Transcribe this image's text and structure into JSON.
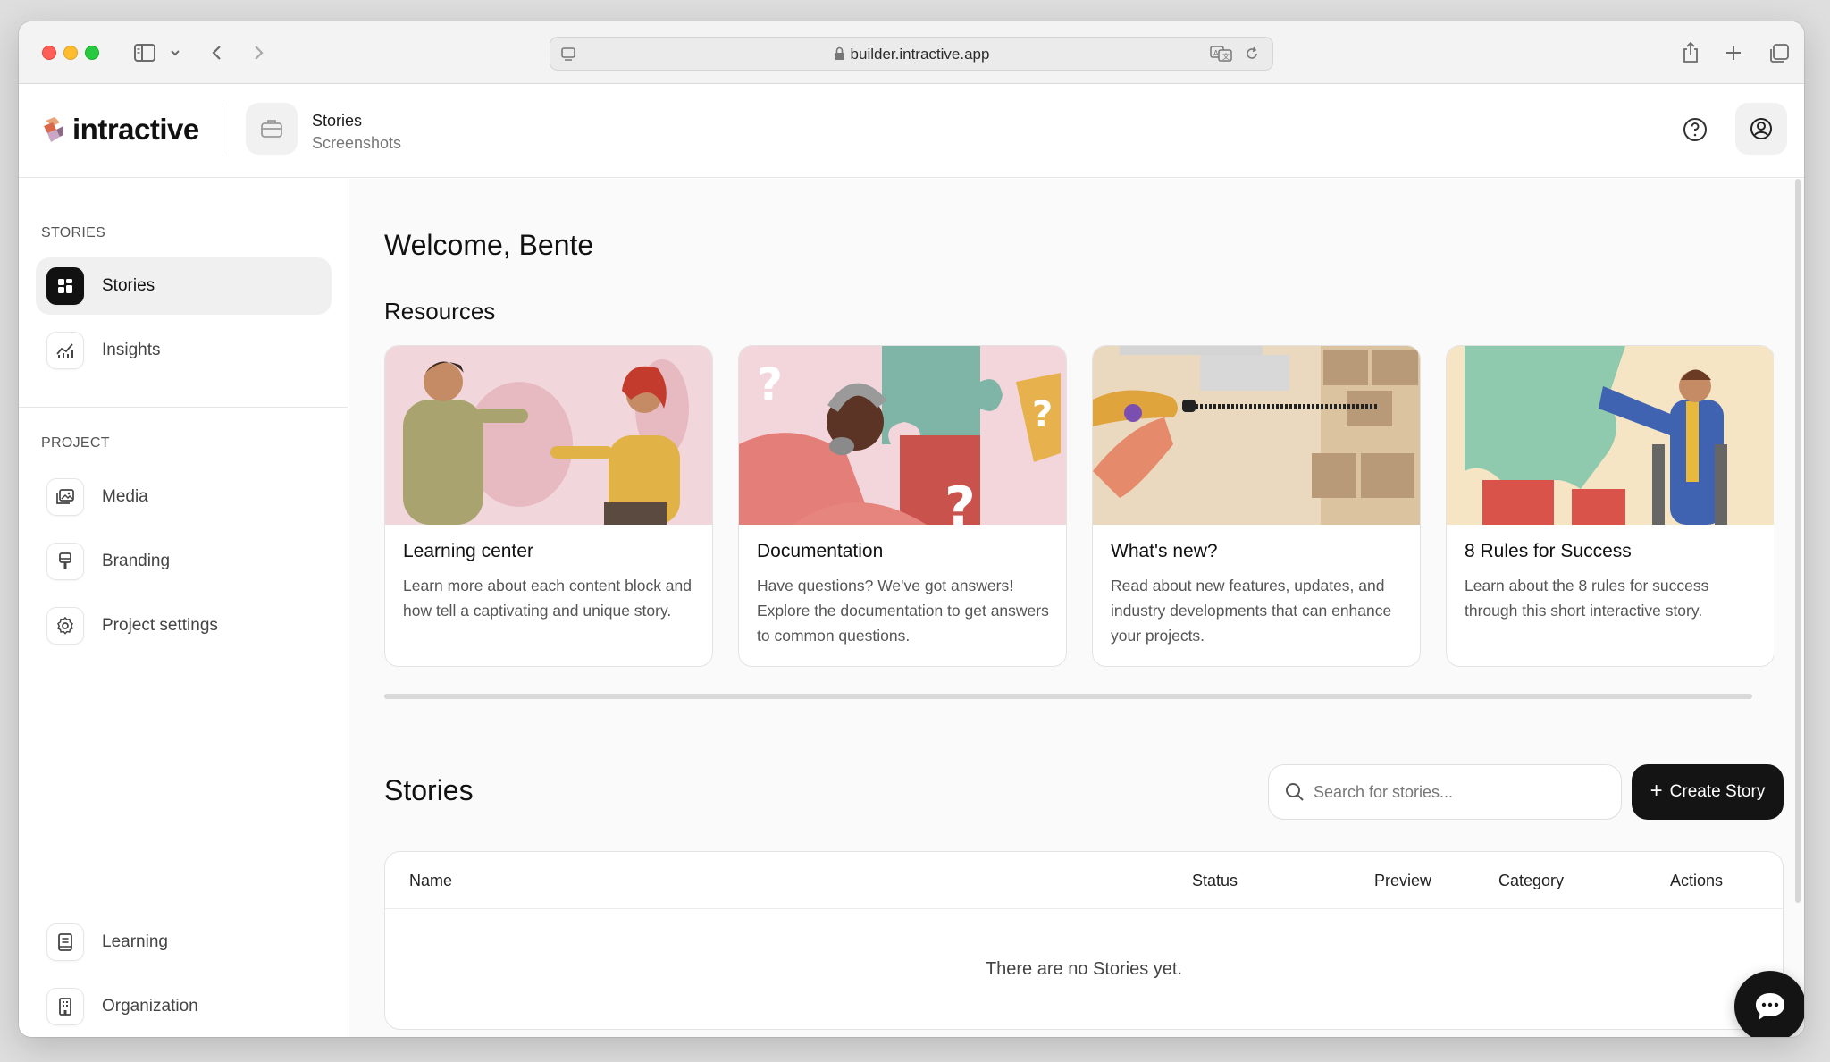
{
  "browser": {
    "url": "builder.intractive.app"
  },
  "header": {
    "logo_text": "intractive",
    "breadcrumb_title": "Stories",
    "breadcrumb_subtitle": "Screenshots"
  },
  "sidebar": {
    "section_stories": "STORIES",
    "section_project": "PROJECT",
    "items": [
      {
        "label": "Stories",
        "icon": "grid-icon",
        "active": true
      },
      {
        "label": "Insights",
        "icon": "chart-icon"
      },
      {
        "label": "Media",
        "icon": "image-icon"
      },
      {
        "label": "Branding",
        "icon": "paint-roller-icon"
      },
      {
        "label": "Project settings",
        "icon": "gear-icon"
      },
      {
        "label": "Learning",
        "icon": "book-icon"
      },
      {
        "label": "Organization",
        "icon": "building-icon"
      }
    ]
  },
  "main": {
    "welcome": "Welcome, Bente",
    "resources_title": "Resources",
    "resources": [
      {
        "title": "Learning center",
        "description": "Learn more about each content block and how tell a captivating and unique story."
      },
      {
        "title": "Documentation",
        "description": "Have questions? We've got answers! Explore the documentation to get answers to common questions."
      },
      {
        "title": "What's new?",
        "description": "Read about new features, updates, and industry developments that can enhance your projects."
      },
      {
        "title": "8 Rules for Success",
        "description": "Learn about the 8 rules for success through this short interactive story."
      }
    ],
    "stories_title": "Stories",
    "search_placeholder": "Search for stories...",
    "create_label": "Create Story",
    "table": {
      "columns": [
        "Name",
        "Status",
        "Preview",
        "Category",
        "Actions"
      ],
      "empty_text": "There are no Stories yet."
    }
  },
  "colors": {
    "primary_button": "#141414",
    "active_item_bg": "#f0f0f0"
  }
}
